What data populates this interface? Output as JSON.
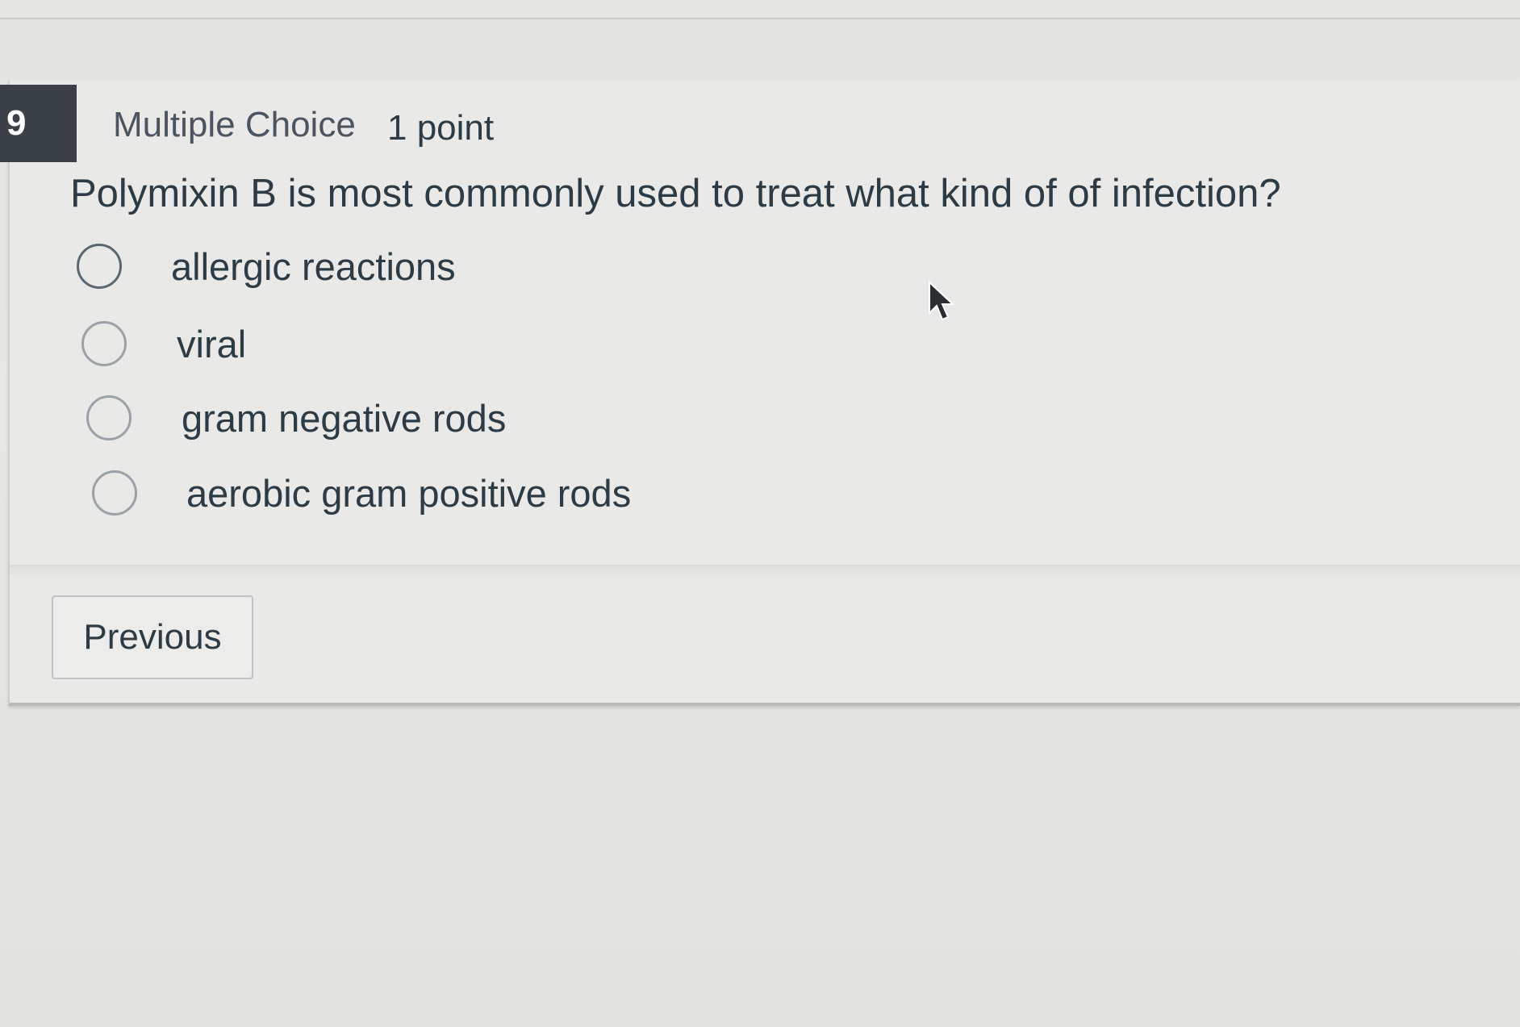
{
  "question": {
    "number": "9",
    "type": "Multiple Choice",
    "points": "1 point",
    "text": "Polymixin B is most commonly used to treat what kind of of infection?",
    "options": [
      {
        "label": "allergic reactions",
        "selected": false
      },
      {
        "label": "viral",
        "selected": false
      },
      {
        "label": "gram negative rods",
        "selected": false
      },
      {
        "label": "aerobic gram positive rods",
        "selected": false
      }
    ]
  },
  "navigation": {
    "previous_label": "Previous"
  },
  "icons": {
    "radio": "radio-unchecked-icon",
    "cursor": "mouse-pointer-icon"
  },
  "colors": {
    "badge_bg": "#3a4045",
    "text": "#2d3b45",
    "background": "#e7e7e5"
  }
}
